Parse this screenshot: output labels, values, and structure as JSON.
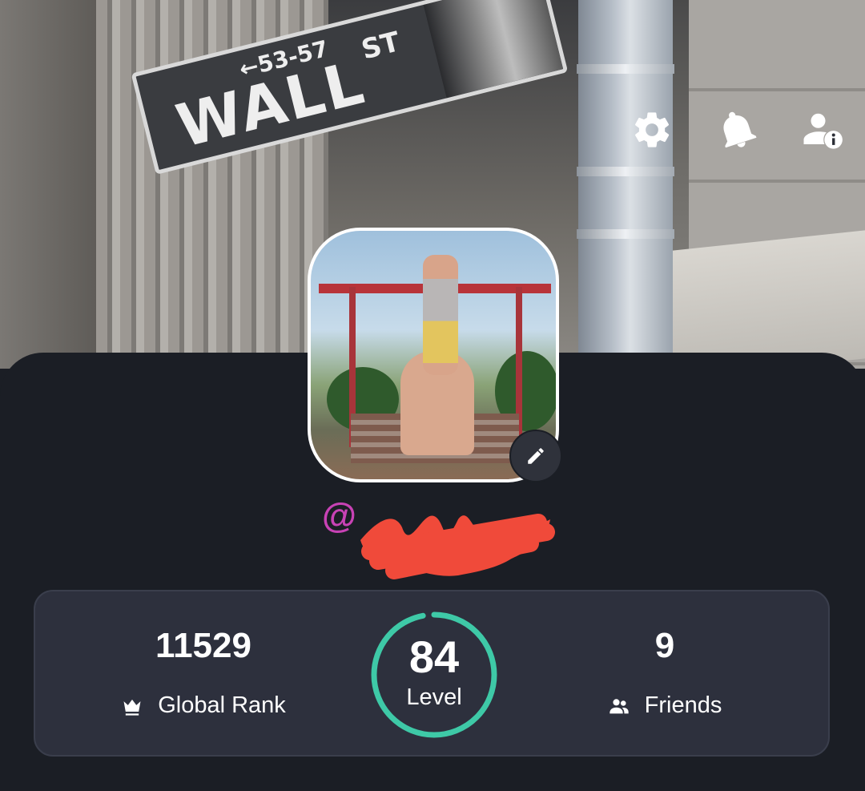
{
  "cover": {
    "sign_main": "WALL",
    "sign_suffix": "ST",
    "sign_numbers": "←53-57"
  },
  "header_icons": [
    {
      "name": "settings",
      "icon": "gear-icon"
    },
    {
      "name": "notifications",
      "icon": "bell-icon"
    },
    {
      "name": "account-info",
      "icon": "user-info-icon"
    }
  ],
  "profile": {
    "username_prefix": "@",
    "username_redacted": true,
    "edit_icon": "pencil-icon"
  },
  "stats": {
    "global_rank": {
      "value": "11529",
      "label": "Global Rank",
      "icon": "crown-icon"
    },
    "level": {
      "value": "84",
      "label": "Level",
      "progress": 0.97
    },
    "friends": {
      "value": "9",
      "label": "Friends",
      "icon": "people-icon"
    }
  },
  "colors": {
    "background": "#1b1e25",
    "card": "#2d303d",
    "level_ring": "#3ec9a7",
    "at_sign": "#c842b5",
    "redaction": "#f04a3a"
  }
}
